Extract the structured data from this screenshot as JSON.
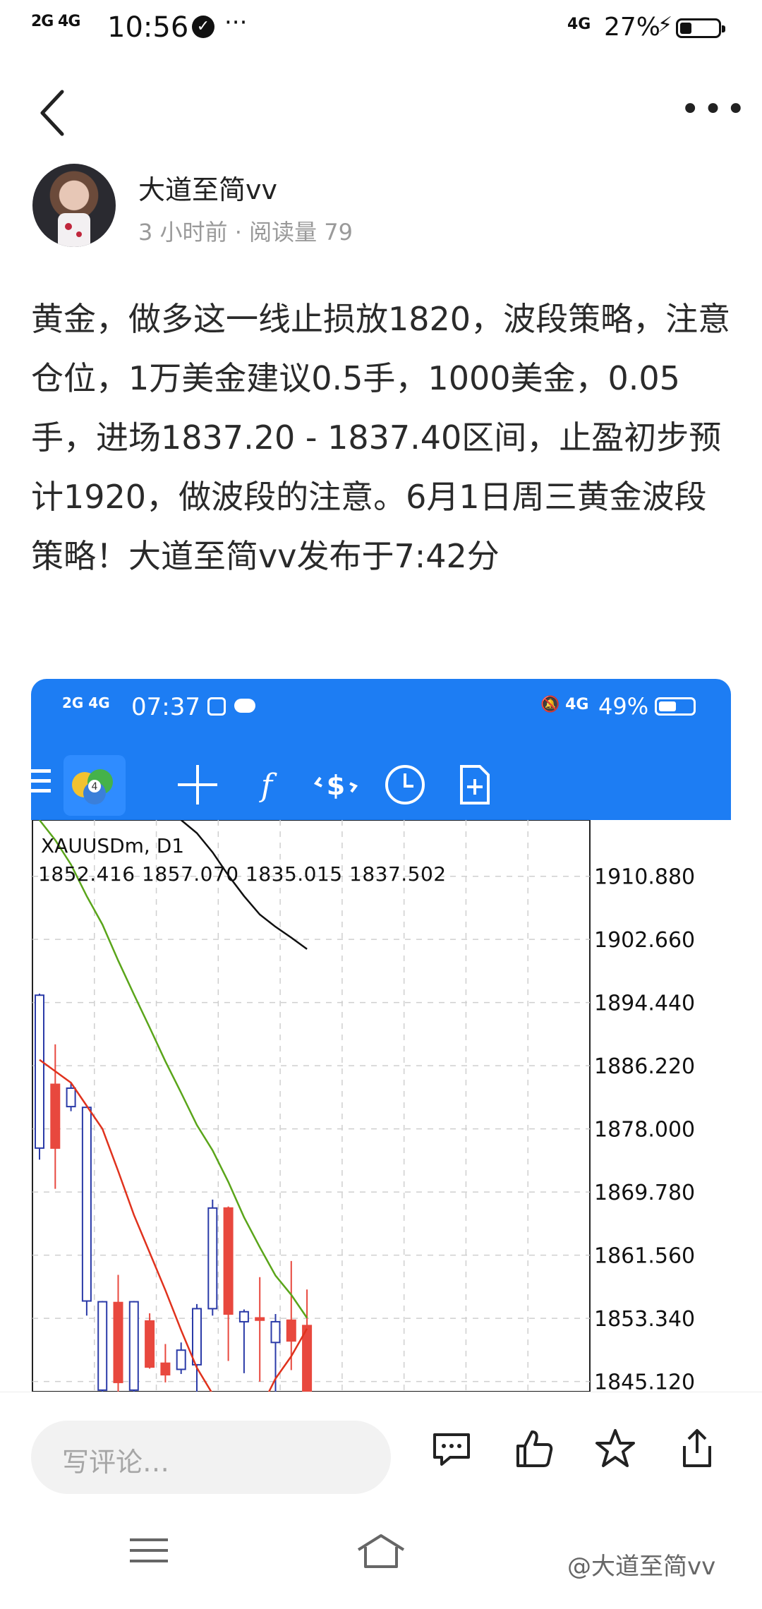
{
  "status_bar": {
    "network": "2G 4G",
    "time": "10:56",
    "signal_right": "4G",
    "battery_percent": "27%",
    "battery_level": 0.27
  },
  "nav": {
    "back_icon": "chevron-left-icon",
    "more_icon": "more-dots-icon"
  },
  "author": {
    "name": "大道至简vv",
    "time_ago": "3 小时前",
    "separator": "·",
    "views_label": "阅读量 79"
  },
  "article": {
    "text": "黄金，做多这一线止损放1820，波段策略，注意仓位，1万美金建议0.5手，1000美金，0.05手，进场1837.20 - 1837.40区间，止盈初步预计1920，做波段的注意。6月1日周三黄金波段策略！大道至简vv发布于7:42分"
  },
  "embedded": {
    "status": {
      "network": "2G 4G",
      "time": "07:37",
      "signal": "4G",
      "battery_percent": "49%",
      "battery_level": 0.49
    },
    "toolbar": {
      "icons": [
        "menu-icon",
        "metatrader-logo-icon",
        "crosshair-icon",
        "function-icon",
        "trade-dollar-icon",
        "clock-icon",
        "new-document-icon"
      ],
      "accent": "#1d7df3"
    },
    "chart": {
      "symbol": "XAUUSDm, D1",
      "ohlc": "1852.416 1857.070 1835.015 1837.502"
    }
  },
  "chart_data": {
    "type": "candlestick",
    "y_ticks": [
      "1910.880",
      "1902.660",
      "1894.440",
      "1886.220",
      "1878.000",
      "1869.780",
      "1861.560",
      "1853.340",
      "1845.120"
    ],
    "ylim": [
      1843.8,
      1918.2
    ],
    "grid": true,
    "bull_color": "#2b3ba8",
    "bear_color": "#e8483e",
    "candles": [
      {
        "o": 1875.5,
        "h": 1895.6,
        "l": 1874.0,
        "c": 1895.4
      },
      {
        "o": 1883.8,
        "h": 1889.0,
        "l": 1870.2,
        "c": 1875.5
      },
      {
        "o": 1880.9,
        "h": 1884.0,
        "l": 1880.3,
        "c": 1883.3
      },
      {
        "o": 1855.6,
        "h": 1881.0,
        "l": 1853.7,
        "c": 1880.8
      },
      {
        "o": 1844.0,
        "h": 1855.6,
        "l": 1841.0,
        "c": 1855.5
      },
      {
        "o": 1855.4,
        "h": 1859.0,
        "l": 1841.0,
        "c": 1845.0
      },
      {
        "o": 1844.0,
        "h": 1855.6,
        "l": 1841.0,
        "c": 1855.5
      },
      {
        "o": 1853.0,
        "h": 1854.0,
        "l": 1846.8,
        "c": 1847.0
      },
      {
        "o": 1847.5,
        "h": 1850.0,
        "l": 1845.0,
        "c": 1846.0
      },
      {
        "o": 1846.7,
        "h": 1850.2,
        "l": 1846.1,
        "c": 1849.2
      },
      {
        "o": 1847.3,
        "h": 1855.2,
        "l": 1843.4,
        "c": 1854.6
      },
      {
        "o": 1854.6,
        "h": 1868.8,
        "l": 1853.7,
        "c": 1867.7
      },
      {
        "o": 1867.7,
        "h": 1867.9,
        "l": 1847.8,
        "c": 1853.9
      },
      {
        "o": 1852.9,
        "h": 1854.5,
        "l": 1846.2,
        "c": 1854.2
      },
      {
        "o": 1853.4,
        "h": 1858.7,
        "l": 1845.1,
        "c": 1853.1
      },
      {
        "o": 1850.2,
        "h": 1853.9,
        "l": 1840.9,
        "c": 1852.9
      },
      {
        "o": 1853.1,
        "h": 1860.8,
        "l": 1846.6,
        "c": 1850.4
      },
      {
        "o": 1852.4,
        "h": 1857.1,
        "l": 1835.0,
        "c": 1837.5
      }
    ],
    "moving_averages": [
      {
        "color": "#e0321d",
        "values": [
          1887.0,
          1885.5,
          1884.0,
          1881.0,
          1878.0,
          1872.5,
          1866.8,
          1861.9,
          1857.0,
          1851.8,
          1846.9,
          1843.5,
          1840.1,
          1838.3,
          1841.4,
          1845.5,
          1848.4,
          1852.0
        ]
      },
      {
        "color": "#5aa51a",
        "values": [
          1918.2,
          1915.6,
          1912.4,
          1908.3,
          1904.6,
          1899.9,
          1895.5,
          1891.2,
          1886.8,
          1882.7,
          1878.5,
          1875.2,
          1871.1,
          1866.5,
          1862.6,
          1858.9,
          1856.4,
          1853.4
        ]
      },
      {
        "color": "#101010",
        "values": [
          null,
          null,
          null,
          null,
          null,
          null,
          null,
          null,
          null,
          1918.2,
          1916.5,
          1914.0,
          1911.0,
          1908.3,
          1905.9,
          1904.3,
          1902.9,
          1901.4
        ]
      }
    ]
  },
  "bottom": {
    "comment_placeholder": "写评论…",
    "icons": [
      "comment-icon",
      "like-icon",
      "favorite-star-icon",
      "share-icon"
    ]
  },
  "system_nav": {
    "watermark": "@大道至简vv"
  }
}
